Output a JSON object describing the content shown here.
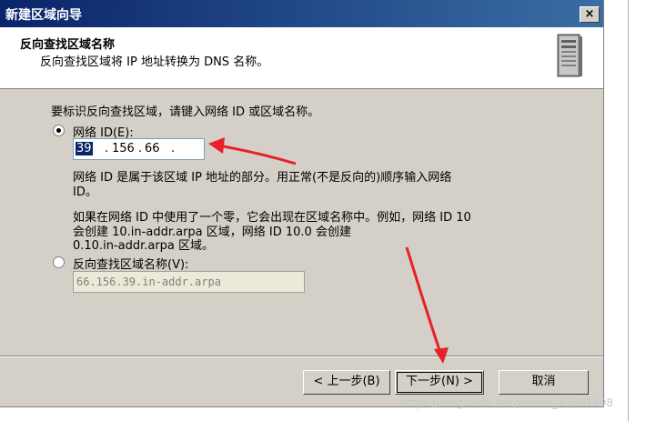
{
  "window": {
    "title": "新建区域向导",
    "close_glyph": "×"
  },
  "header": {
    "title": "反向查找区域名称",
    "subtitle": "反向查找区域将 IP 地址转换为 DNS 名称。",
    "icon": "server-icon"
  },
  "content": {
    "intro": "要标识反向查找区域，请键入网络 ID 或区域名称。",
    "network_id_option": {
      "label": "网络 ID(E):",
      "selected": true
    },
    "network_id_value": {
      "octet1": "39",
      "octet2": "156",
      "octet3": "66",
      "octet4": "",
      "separator": "."
    },
    "help1_line1": "网络 ID 是属于该区域 IP 地址的部分。用正常(不是反向的)顺序输入网络",
    "help1_line2": "ID。",
    "help2_line1": "如果在网络 ID 中使用了一个零，它会出现在区域名称中。例如，网络 ID 10",
    "help2_line2": "会创建 10.in-addr.arpa 区域，网络 ID 10.0 会创建",
    "help2_line3": "0.10.in-addr.arpa 区域。",
    "zone_name_option": {
      "label": "反向查找区域名称(V):",
      "selected": false
    },
    "zone_name_value": "66.156.39.in-addr.arpa"
  },
  "buttons": {
    "back": "< 上一步(B)",
    "next": "下一步(N) >",
    "cancel": "取消"
  },
  "watermark": "https://blog.csdn.net/weixin_43801398",
  "colors": {
    "annotation_arrow": "#e8202a",
    "title_bar": "#0a246a"
  }
}
